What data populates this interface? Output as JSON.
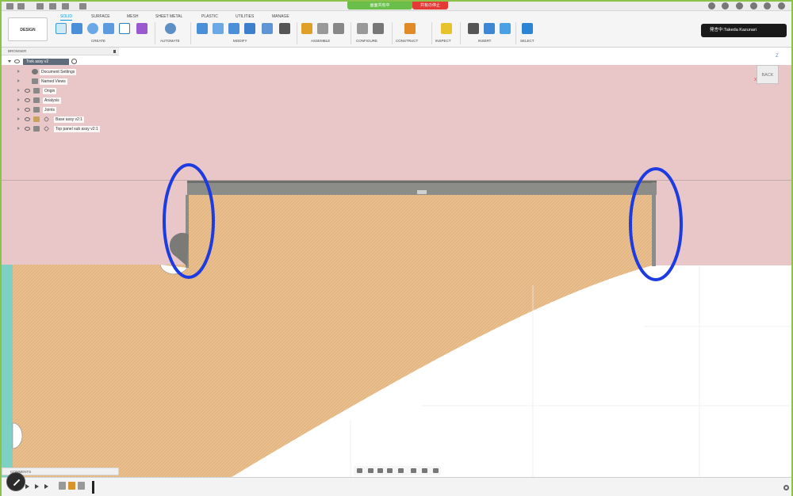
{
  "top_bar": {
    "share_status": "画面共有中",
    "share_stop": "共有の停止"
  },
  "ribbon": {
    "workspace": "DESIGN",
    "tabs": [
      "SOLID",
      "SURFACE",
      "MESH",
      "SHEET METAL",
      "PLASTIC",
      "UTILITIES",
      "MANAGE"
    ],
    "active_tab": "SOLID",
    "groups": [
      "CREATE",
      "AUTOMATE",
      "MODIFY",
      "ASSEMBLE",
      "CONFIGURE",
      "CONSTRUCT",
      "INSPECT",
      "INSERT",
      "SELECT"
    ]
  },
  "presenter": {
    "label": "発言中:Takeda Kazunari"
  },
  "browser": {
    "title": "BROWSER",
    "root": "Trek assy v2",
    "items": [
      {
        "label": "Document Settings",
        "icon": "gear-icon"
      },
      {
        "label": "Named Views",
        "icon": "folder-icon"
      },
      {
        "label": "Origin",
        "icon": "folder-icon"
      },
      {
        "label": "Analysis",
        "icon": "folder-icon"
      },
      {
        "label": "Joints",
        "icon": "folder-icon"
      },
      {
        "label": "Base assy v2:1",
        "icon": "component-icon"
      },
      {
        "label": "Top panel sub assy v2:1",
        "icon": "component-icon"
      }
    ]
  },
  "viewcube": {
    "face": "BACK",
    "axis_z": "Z",
    "axis_x": "X"
  },
  "comments": {
    "title": "COMMENTS"
  },
  "colors": {
    "pink_plate": "#e9c6c8",
    "wood": "#e9bf8d",
    "gray_rail": "#8c8c88",
    "teal_edge": "#7ed0c2",
    "highlight": "#1c3be0",
    "accent": "#0696d7"
  }
}
